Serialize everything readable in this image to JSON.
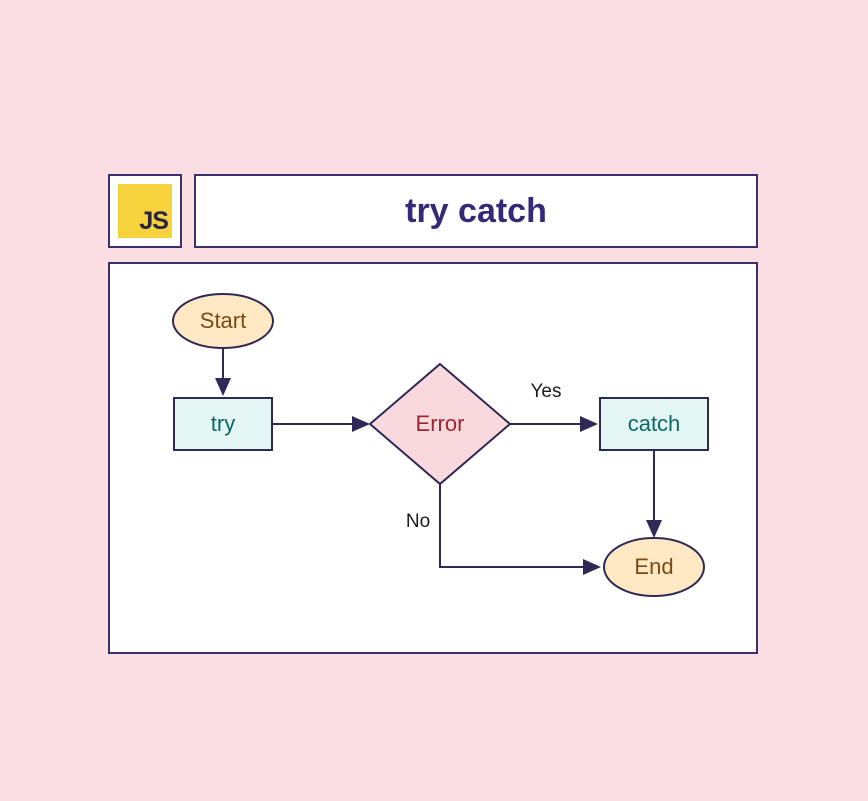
{
  "header": {
    "logo_text": "JS",
    "title": "try catch"
  },
  "diagram": {
    "nodes": {
      "start": "Start",
      "try": "try",
      "error": "Error",
      "catch": "catch",
      "end": "End"
    },
    "edge_labels": {
      "yes": "Yes",
      "no": "No"
    },
    "colors": {
      "border": "#3a2e6e",
      "terminator_fill": "#ffe8c4",
      "process_fill": "#e4f6f4",
      "decision_fill": "#f9d9de",
      "background": "#fbdee3"
    }
  }
}
